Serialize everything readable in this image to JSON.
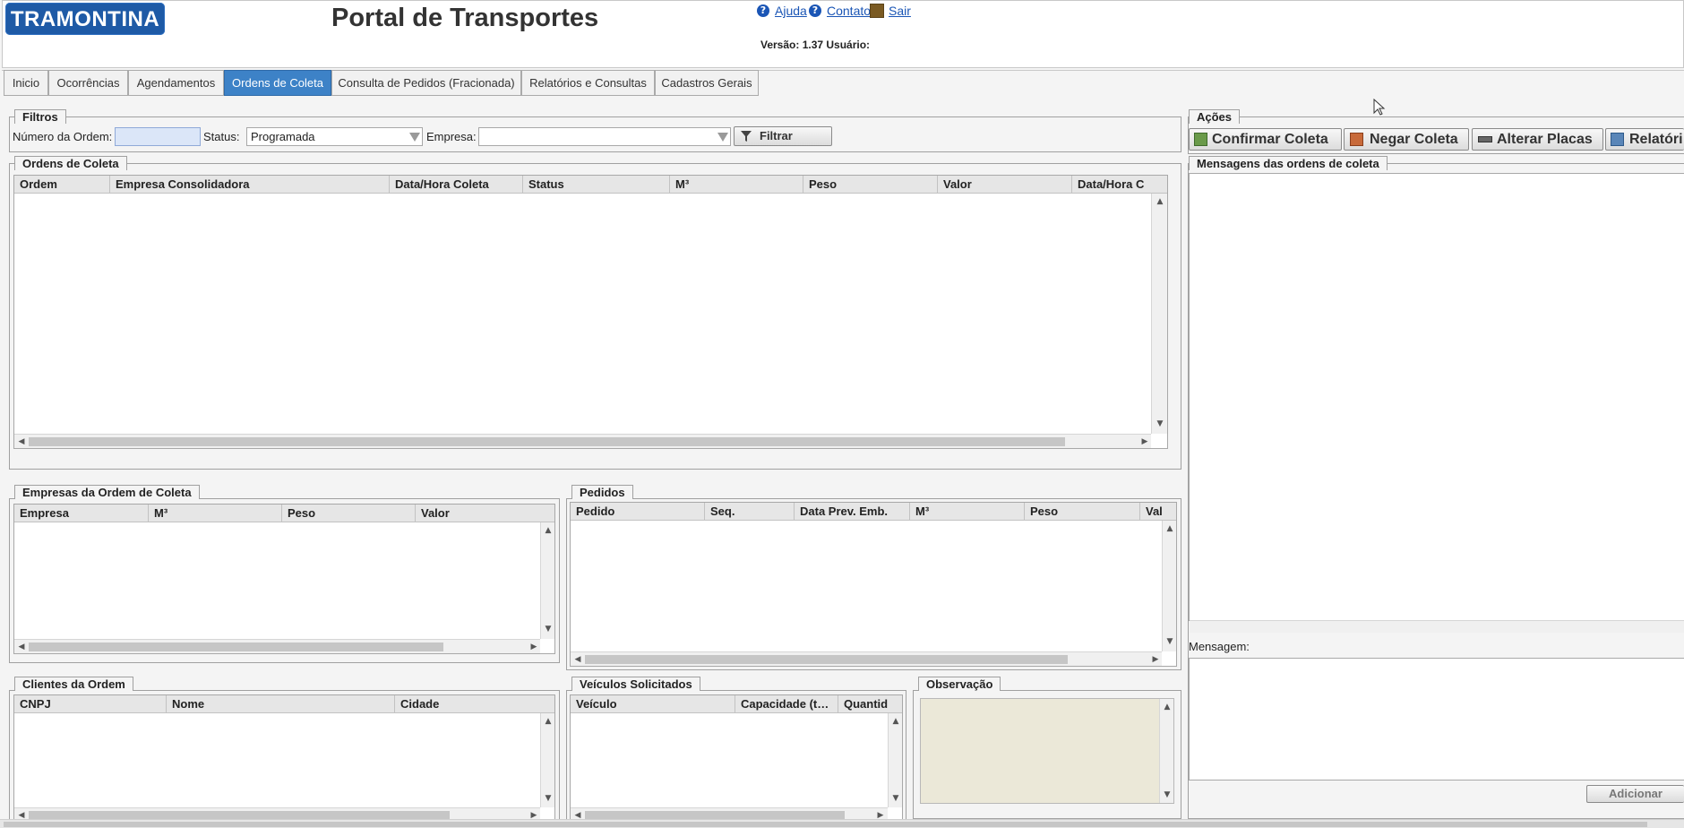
{
  "header": {
    "logo_text": "TRAMONTINA",
    "title": "Portal de Transportes",
    "links": {
      "help": "Ajuda",
      "contact": "Contato",
      "logout": "Sair"
    },
    "version": "Versão: 1.37 Usuário:"
  },
  "tabs": [
    {
      "label": "Inicio"
    },
    {
      "label": "Ocorrências"
    },
    {
      "label": "Agendamentos"
    },
    {
      "label": "Ordens de Coleta",
      "active": true
    },
    {
      "label": "Consulta de Pedidos (Fracionada)"
    },
    {
      "label": "Relatórios e Consultas"
    },
    {
      "label": "Cadastros Gerais"
    }
  ],
  "filters": {
    "legend": "Filtros",
    "order_number_label": "Número da Ordem:",
    "order_number_value": "",
    "status_label": "Status:",
    "status_value": "Programada",
    "company_label": "Empresa:",
    "company_value": "",
    "filter_button": "Filtrar"
  },
  "orders": {
    "legend": "Ordens de Coleta",
    "columns": [
      "Ordem",
      "Empresa Consolidadora",
      "Data/Hora Coleta",
      "Status",
      "M³",
      "Peso",
      "Valor",
      "Data/Hora C"
    ],
    "rows": []
  },
  "companies": {
    "legend": "Empresas da Ordem de Coleta",
    "columns": [
      "Empresa",
      "M³",
      "Peso",
      "Valor"
    ],
    "rows": []
  },
  "pedidos": {
    "legend": "Pedidos",
    "columns": [
      "Pedido",
      "Seq.",
      "Data Prev. Emb.",
      "M³",
      "Peso",
      "Val"
    ],
    "rows": []
  },
  "clients": {
    "legend": "Clientes da Ordem",
    "columns": [
      "CNPJ",
      "Nome",
      "Cidade"
    ],
    "rows": []
  },
  "vehicles": {
    "legend": "Veículos Solicitados",
    "columns": [
      "Veículo",
      "Capacidade (t…",
      "Quantid"
    ],
    "rows": []
  },
  "observation": {
    "legend": "Observação",
    "value": ""
  },
  "actions": {
    "legend": "Ações",
    "buttons": [
      "Confirmar Coleta",
      "Negar Coleta",
      "Alterar Placas",
      "Relatóri"
    ]
  },
  "messages": {
    "legend": "Mensagens das ordens de coleta",
    "message_label": "Mensagem:",
    "message_value": "",
    "add_button": "Adicionar"
  },
  "colors": {
    "brand": "#1e5aa6",
    "active_tab": "#3d82c7",
    "link": "#1a55b5",
    "observation_bg": "#ebe8d8"
  }
}
